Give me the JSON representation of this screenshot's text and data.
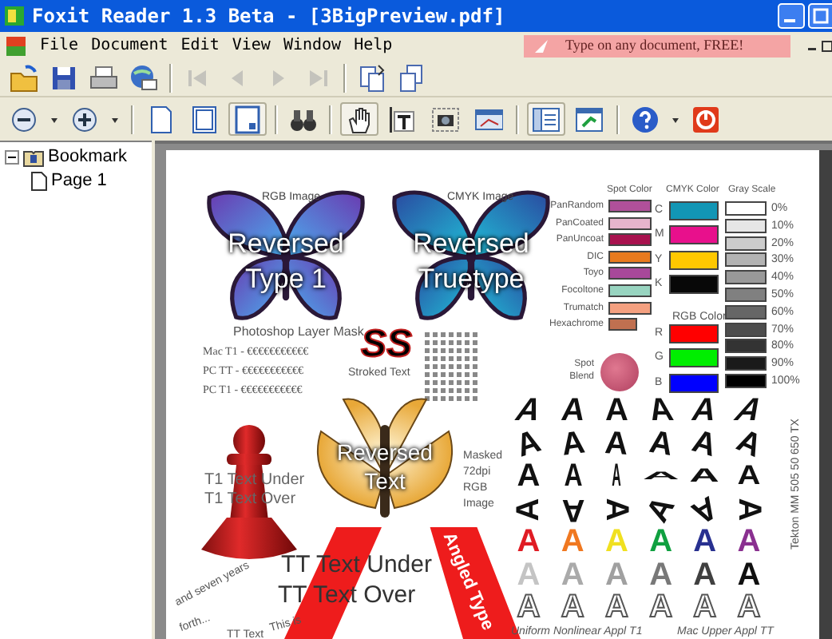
{
  "window": {
    "title": "Foxit Reader 1.3 Beta - [3BigPreview.pdf]"
  },
  "menu": [
    "File",
    "Document",
    "Edit",
    "View",
    "Window",
    "Help"
  ],
  "ad_banner": "Type on any document, FREE!",
  "navigation_buttons": [
    {
      "disabled": true
    },
    {
      "disabled": true
    },
    {
      "disabled": true
    },
    {
      "disabled": true
    }
  ],
  "view_buttons": [
    {
      "selected": false
    },
    {
      "selected": false
    },
    {
      "selected": true
    }
  ],
  "tool_buttons": [
    {
      "selected": true
    },
    {
      "selected": false
    },
    {
      "selected": false
    },
    {
      "selected": false
    }
  ],
  "panel_buttons": [
    {
      "selected": true
    },
    {
      "selected": false
    }
  ],
  "bookmarks": [
    {
      "label": "Bookmark",
      "expanded": true,
      "children": [
        {
          "label": "Page 1"
        }
      ]
    }
  ],
  "document": {
    "image_labels": [
      "RGB Image",
      "CMYK Image"
    ],
    "butterflies": [
      {
        "lines": [
          "Reversed",
          "Type 1"
        ]
      },
      {
        "lines": [
          "Reversed",
          "Truetype"
        ]
      }
    ],
    "layer_mask_caption": "Photoshop Layer Mask",
    "font_samples": [
      "Mac T1 - €€€€€€€€€€€",
      "PC TT - €€€€€€€€€€€",
      "PC T1 - €€€€€€€€€€€"
    ],
    "stroked": {
      "text": "SS",
      "caption": "Stroked Text"
    },
    "spot_colors": {
      "title": "Spot Color",
      "rows": [
        {
          "label": "PanRandom",
          "color": "#b0509a"
        },
        {
          "label": "PanCoated",
          "color": "#e6b4cc"
        },
        {
          "label": "PanUncoat",
          "color": "#a8124e"
        },
        {
          "label": "DIC",
          "color": "#e87a1e"
        },
        {
          "label": "Toyo",
          "color": "#a8489a"
        },
        {
          "label": "Focoltone",
          "color": "#98d4c0"
        },
        {
          "label": "Trumatch",
          "color": "#f4a080"
        },
        {
          "label": "Hexachrome",
          "color": "#c07050"
        }
      ]
    },
    "spot_blend": "Spot Blend",
    "cmyk": {
      "title": "CMYK Color",
      "rows": [
        {
          "label": "C",
          "color": "#1296b5"
        },
        {
          "label": "M",
          "color": "#e8108c"
        },
        {
          "label": "Y",
          "color": "#ffc800"
        },
        {
          "label": "K",
          "color": "#080808"
        }
      ]
    },
    "rgb": {
      "title": "RGB Color",
      "rows": [
        {
          "label": "R",
          "color": "#ff0000"
        },
        {
          "label": "G",
          "color": "#00ee00"
        },
        {
          "label": "B",
          "color": "#0000ff"
        }
      ]
    },
    "gray_scale": {
      "title": "Gray Scale",
      "rows": [
        {
          "label": "0%",
          "color": "#ffffff"
        },
        {
          "label": "10%",
          "color": "#e6e6e6"
        },
        {
          "label": "20%",
          "color": "#cccccc"
        },
        {
          "label": "30%",
          "color": "#b3b3b3"
        },
        {
          "label": "40%",
          "color": "#999999"
        },
        {
          "label": "50%",
          "color": "#808080"
        },
        {
          "label": "60%",
          "color": "#666666"
        },
        {
          "label": "70%",
          "color": "#4d4d4d"
        },
        {
          "label": "80%",
          "color": "#333333"
        },
        {
          "label": "90%",
          "color": "#1a1a1a"
        },
        {
          "label": "100%",
          "color": "#000000"
        }
      ]
    },
    "pawn_captions": [
      "T1 Text Under",
      "T1 Text Over"
    ],
    "moth_lines": [
      "Reversed",
      "Text"
    ],
    "masked_caption": [
      "Masked",
      "72dpi",
      "RGB",
      "Image"
    ],
    "ribbon_text": "Angled Type",
    "tt_captions": [
      "TT Text Under",
      "TT Text Over"
    ],
    "curved_text": [
      "This is",
      "and seven years",
      "forth...",
      "TT Text"
    ],
    "glyph_rows": [
      {
        "kind": "distorted",
        "glyphs": [
          {
            "text": "A"
          },
          {
            "text": "A"
          },
          {
            "text": "A"
          },
          {
            "text": "A"
          },
          {
            "text": "A"
          },
          {
            "text": "A"
          }
        ]
      },
      {
        "kind": "distorted",
        "glyphs": [
          {
            "text": "A"
          },
          {
            "text": "A"
          },
          {
            "text": "A"
          },
          {
            "text": "A"
          },
          {
            "text": "A"
          },
          {
            "text": "A"
          }
        ]
      },
      {
        "kind": "distorted",
        "glyphs": [
          {
            "text": "A"
          },
          {
            "text": "A"
          },
          {
            "text": "A"
          },
          {
            "text": "A"
          },
          {
            "text": "A"
          },
          {
            "text": "A"
          }
        ]
      },
      {
        "kind": "distorted",
        "glyphs": [
          {
            "text": "A"
          },
          {
            "text": "A"
          },
          {
            "text": "A"
          },
          {
            "text": "A"
          },
          {
            "text": "A"
          },
          {
            "text": "A"
          }
        ]
      },
      {
        "kind": "colored",
        "glyphs": [
          {
            "text": "A",
            "color": "#e01c24"
          },
          {
            "text": "A",
            "color": "#f07820"
          },
          {
            "text": "A",
            "color": "#f0e020"
          },
          {
            "text": "A",
            "color": "#10a040"
          },
          {
            "text": "A",
            "color": "#283090"
          },
          {
            "text": "A",
            "color": "#8a3090"
          }
        ]
      },
      {
        "kind": "colored",
        "glyphs": [
          {
            "text": "A",
            "color": "#c4c4c4"
          },
          {
            "text": "A",
            "color": "#aaaaaa"
          },
          {
            "text": "A",
            "color": "#a0a0a0"
          },
          {
            "text": "A",
            "color": "#787878"
          },
          {
            "text": "A",
            "color": "#404040"
          },
          {
            "text": "A",
            "color": "#101010"
          }
        ]
      },
      {
        "kind": "outline",
        "glyphs": [
          {
            "text": "A"
          },
          {
            "text": "A"
          },
          {
            "text": "A"
          },
          {
            "text": "A"
          },
          {
            "text": "A"
          },
          {
            "text": "A"
          }
        ]
      }
    ],
    "glyph_captions": [
      "Uniform Nonlinear Appl T1",
      "Mac Upper Appl TT"
    ],
    "vertical_label": "Tekton MM 505 50 650 TX"
  }
}
